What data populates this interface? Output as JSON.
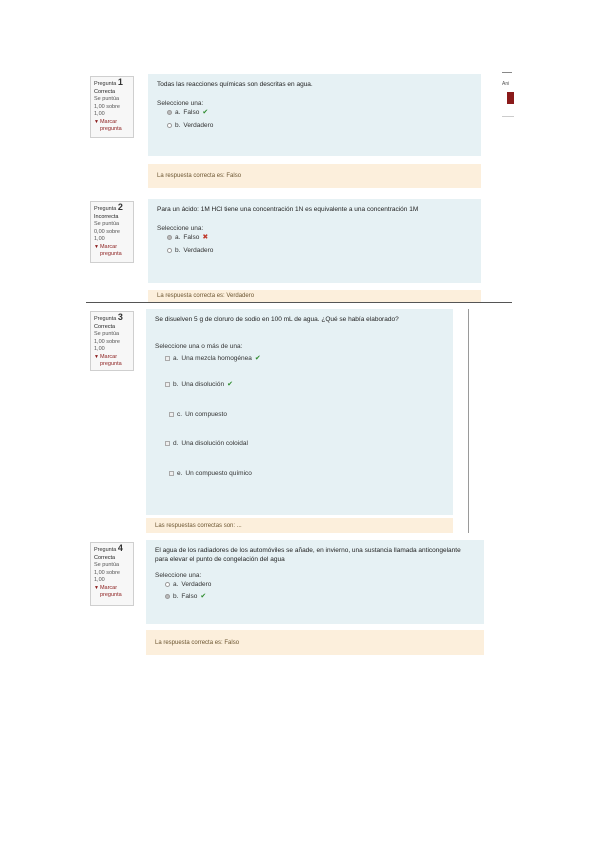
{
  "questions": [
    {
      "label": "Pregunta",
      "number": "1",
      "state": "Correcta",
      "grade": "Se puntúa 1,00 sobre 1,00",
      "flag": "Marcar pregunta",
      "text": "Todas las reacciones químicas son descritas en agua.",
      "prompt": "Seleccione una:",
      "options": [
        {
          "letter": "a.",
          "text": "Falso",
          "checked": true,
          "mark": "✔"
        },
        {
          "letter": "b.",
          "text": "Verdadero",
          "checked": false,
          "mark": ""
        }
      ],
      "feedback": "La respuesta correcta es: Falso"
    },
    {
      "label": "Pregunta",
      "number": "2",
      "state": "Incorrecta",
      "grade": "Se puntúa 0,00 sobre 1,00",
      "flag": "Marcar pregunta",
      "text": "Para un ácido: 1M HCl tiene una concentración 1N es equivalente a una concentración 1M",
      "prompt": "Seleccione una:",
      "options": [
        {
          "letter": "a.",
          "text": "Falso",
          "checked": true,
          "mark": "✖"
        },
        {
          "letter": "b.",
          "text": "Verdadero",
          "checked": false,
          "mark": ""
        }
      ],
      "feedback": "La respuesta correcta es: Verdadero"
    },
    {
      "label": "Pregunta",
      "number": "3",
      "state": "Correcta",
      "grade": "Se puntúa 1,00 sobre 1,00",
      "flag": "Marcar pregunta",
      "text": "Se disuelven 5 g de cloruro de sodio en 100 mL de agua. ¿Qué se había elaborado?",
      "prompt": "Seleccione una o más de una:",
      "options": [
        {
          "letter": "a.",
          "text": "Una mezcla homogénea",
          "checked": true,
          "mark": "✔"
        },
        {
          "letter": "b.",
          "text": "Una disolución",
          "checked": true,
          "mark": "✔"
        },
        {
          "letter": "c.",
          "text": "Un compuesto",
          "checked": false,
          "mark": ""
        },
        {
          "letter": "d.",
          "text": "Una disolución coloidal",
          "checked": false,
          "mark": ""
        },
        {
          "letter": "e.",
          "text": "Un compuesto químico",
          "checked": false,
          "mark": ""
        }
      ],
      "feedback": "Las respuestas correctas son: ..."
    },
    {
      "label": "Pregunta",
      "number": "4",
      "state": "Correcta",
      "grade": "Se puntúa 1,00 sobre 1,00",
      "flag": "Marcar pregunta",
      "text": "El agua de los radiadores de los automóviles se añade, en invierno, una sustancia llamada anticongelante para elevar el punto de congelación del agua",
      "prompt": "Seleccione una:",
      "options": [
        {
          "letter": "a.",
          "text": "Verdadero",
          "checked": false,
          "mark": ""
        },
        {
          "letter": "b.",
          "text": "Falso",
          "checked": true,
          "mark": "✔"
        }
      ],
      "feedback": "La respuesta correcta es: Falso"
    }
  ],
  "side_panel": {
    "text": "Ani"
  },
  "colors": {
    "question_bg": "#e6f1f4",
    "feedback_bg": "#fcefdc",
    "brand": "#8a1a1a"
  }
}
